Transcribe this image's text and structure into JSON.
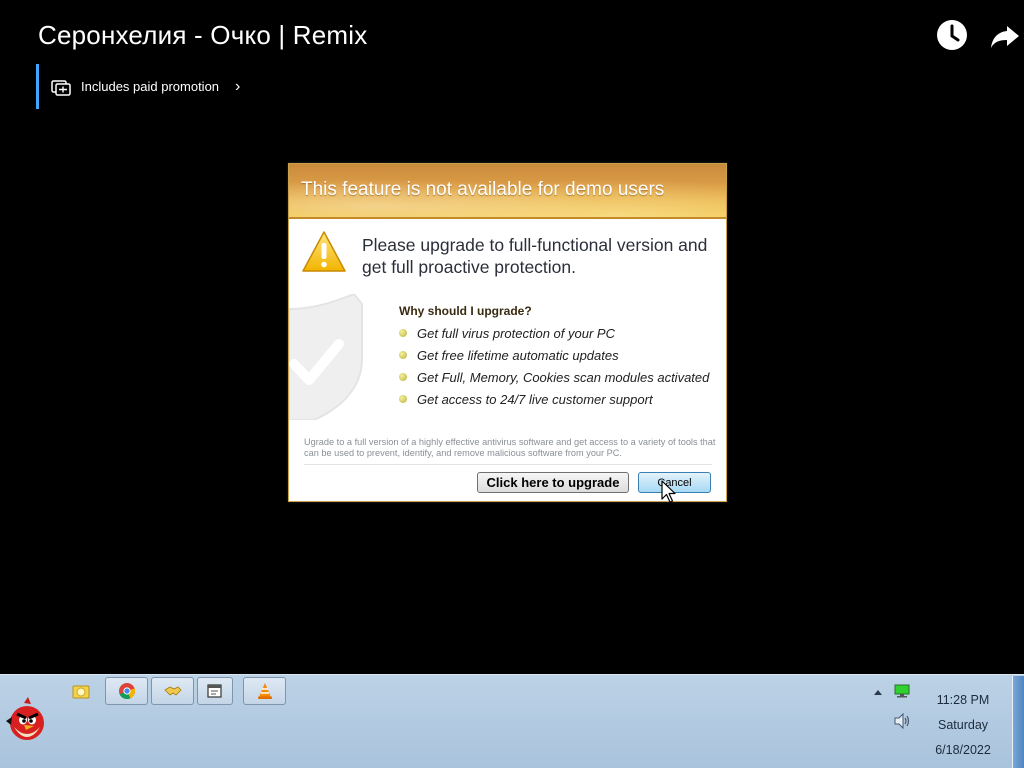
{
  "video": {
    "title": "Серонхелия - Очко | Remix",
    "promotion_label": "Includes paid promotion"
  },
  "dialog": {
    "title": "This feature is not available for demo users",
    "headline": "Please upgrade to full-functional version and get full proactive protection.",
    "why_heading": "Why should I upgrade?",
    "features": [
      "Get full virus protection of your PC",
      "Get free lifetime automatic updates",
      "Get Full, Memory, Cookies scan modules activated",
      "Get access to 24/7 live customer support"
    ],
    "footnote": "Ugrade to a full version of a highly effective antivirus software and get access to a variety of tools that can be used to prevent, identify, and remove malicious software from your PC.",
    "upgrade_button": "Click here to upgrade",
    "cancel_button": "Cancel"
  },
  "taskbar": {
    "time": "11:28 PM",
    "day": "Saturday",
    "date": "6/18/2022",
    "pinned_icons": [
      "chrome-icon",
      "handshake-icon",
      "window-icon",
      "vlc-icon"
    ]
  },
  "colors": {
    "promo_accent": "#3ea6ff",
    "dialog_header": "#e3a846",
    "taskbar": "#b3cbe1"
  }
}
